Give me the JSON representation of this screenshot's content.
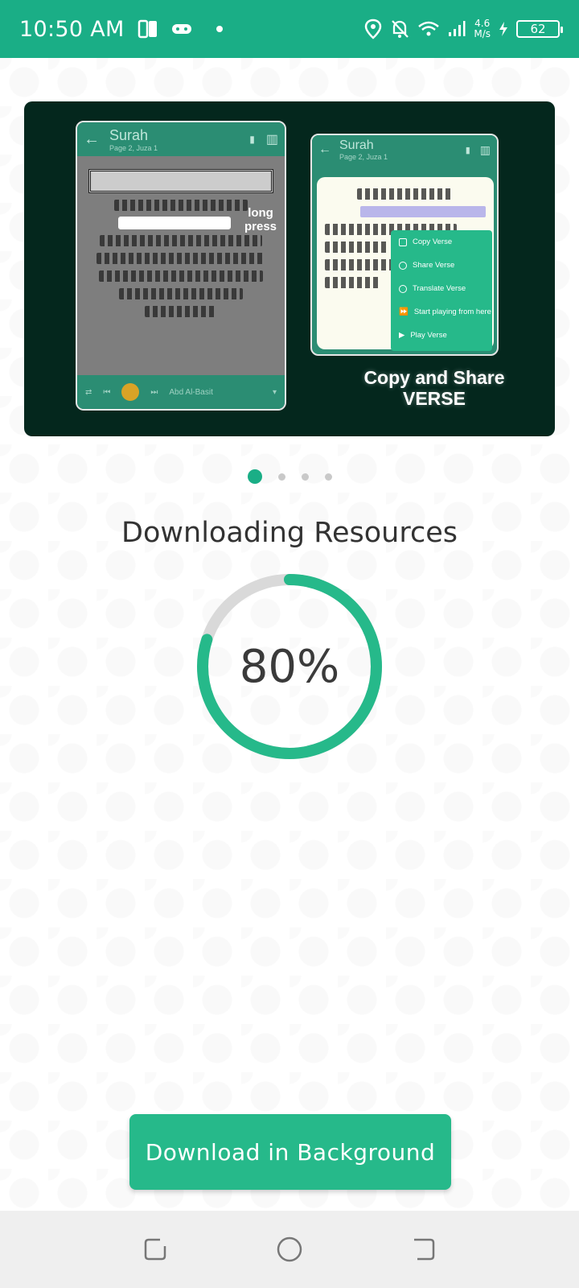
{
  "status_bar": {
    "time": "10:50 AM",
    "net_speed_value": "4.6",
    "net_speed_unit": "M/s",
    "battery": "62",
    "icons": [
      "document-icon",
      "gamepad-icon",
      "dot-icon",
      "location-icon",
      "bell-off-icon",
      "wifi-icon",
      "signal-icon",
      "charging-icon"
    ],
    "color": "#1aae86"
  },
  "banner": {
    "phone_left": {
      "title": "Surah",
      "subtitle": "Page 2, Juza 1",
      "reciter": "Abd Al-Basit"
    },
    "long_press_label_1": "long",
    "long_press_label_2": "press",
    "phone_right": {
      "title": "Surah",
      "subtitle": "Page 2, Juza 1",
      "menu": [
        "Copy Verse",
        "Share Verse",
        "Translate Verse",
        "Start playing from here",
        "Play Verse"
      ]
    },
    "caption_line1": "Copy and Share",
    "caption_line2": "VERSE"
  },
  "pager": {
    "count": 4,
    "active_index": 0
  },
  "heading": "Downloading Resources",
  "progress": {
    "percent_label": "80%",
    "fraction": 0.8,
    "color": "#26b98a"
  },
  "button_label": "Download in Background",
  "nav": [
    "recents-icon",
    "home-icon",
    "back-icon"
  ]
}
